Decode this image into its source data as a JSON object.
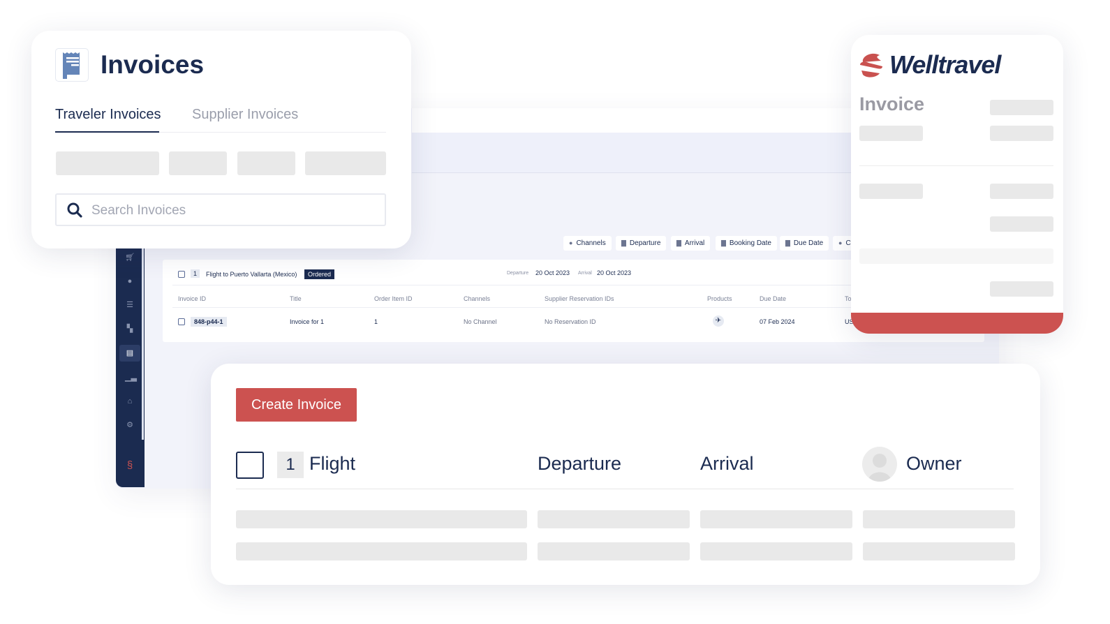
{
  "invoices_card": {
    "title": "Invoices",
    "tabs": [
      {
        "label": "Traveler Invoices",
        "active": true
      },
      {
        "label": "Supplier Invoices",
        "active": false
      }
    ],
    "search": {
      "placeholder": "Search Invoices"
    }
  },
  "filters": [
    {
      "icon": "user-icon",
      "label": "Channels"
    },
    {
      "icon": "calendar-icon",
      "label": "Departure"
    },
    {
      "icon": "calendar-icon",
      "label": "Arrival"
    },
    {
      "icon": "calendar-icon",
      "label": "Booking Date"
    },
    {
      "icon": "calendar-icon",
      "label": "Due Date"
    },
    {
      "icon": "user-icon",
      "label": "C"
    }
  ],
  "order": {
    "number": "1",
    "title": "Flight to Puerto Vallarta (Mexico)",
    "status": "Ordered",
    "departure_label": "Departure",
    "departure": "20 Oct 2023",
    "arrival_label": "Arrival",
    "arrival": "20 Oct 2023"
  },
  "table": {
    "columns": [
      "Invoice ID",
      "Title",
      "Order Item ID",
      "Channels",
      "Supplier Reservation IDs",
      "Products",
      "Due Date",
      "To"
    ],
    "rows": [
      {
        "invoice_id": "848-p44-1",
        "title": "Invoice for 1",
        "order_item_id": "1",
        "channels": "No Channel",
        "supplier_reservation": "No Reservation ID",
        "product": "plane-icon",
        "due_date": "07 Feb 2024",
        "total": "US"
      }
    ]
  },
  "welltravel": {
    "brand": "Welltravel",
    "heading": "Invoice",
    "accent": "#c9514f"
  },
  "create_card": {
    "button": "Create Invoice",
    "number": "1",
    "type": "Flight",
    "departure": "Departure",
    "arrival": "Arrival",
    "owner": "Owner"
  },
  "colors": {
    "navy": "#1b2b50",
    "red": "#cc5250",
    "icon_blue": "#6485b8"
  }
}
